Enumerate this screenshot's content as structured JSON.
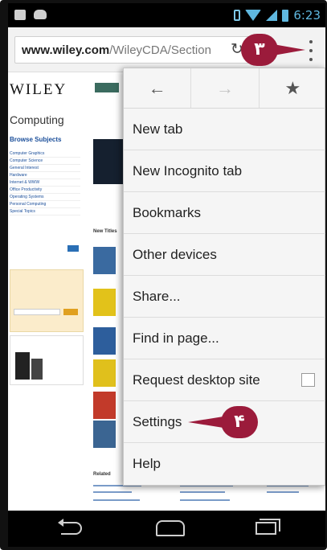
{
  "status_bar": {
    "time": "6:23"
  },
  "url_bar": {
    "url_domain": "www.wiley.com",
    "url_path": "/WileyCDA/Section"
  },
  "callouts": {
    "step_menu": "۳",
    "step_settings": "۴"
  },
  "background_page": {
    "logo": "WILEY",
    "heading": "Computing",
    "browse_subjects": "Browse Subjects",
    "subject_links": [
      "Computer Graphics",
      "Computer Science",
      "General Interest",
      "Hardware",
      "Internet & WWW",
      "Office Productivity",
      "Operating Systems",
      "Personal Computing",
      "Special Topics"
    ],
    "new_titles": "New Titles",
    "related": "Related"
  },
  "menu": {
    "icons": [
      "back-icon",
      "forward-icon",
      "bookmark-star-icon"
    ],
    "items": [
      "New tab",
      "New Incognito tab",
      "Bookmarks",
      "Other devices",
      "Share...",
      "Find in page...",
      "Request desktop site",
      "Settings",
      "Help"
    ],
    "request_desktop_checked": false
  },
  "colors": {
    "callout": "#9b1b3b",
    "status_accent": "#5fb8e0"
  }
}
